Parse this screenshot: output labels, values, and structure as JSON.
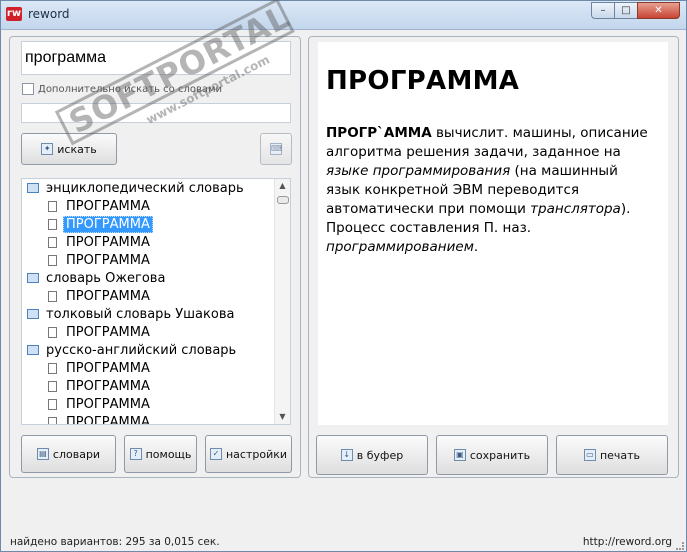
{
  "window": {
    "title": "reword",
    "icon_text": "rw",
    "buttons": {
      "minimize": "–",
      "maximize": "□",
      "close": "✕"
    }
  },
  "search": {
    "value": "программа",
    "option_label": "Дополнительно искать со словами",
    "extra_value": "",
    "search_label": "искать"
  },
  "tree": {
    "items": [
      {
        "type": "dict",
        "label": "энциклопедический словарь"
      },
      {
        "type": "entry",
        "label": "ПРОГРАММА"
      },
      {
        "type": "entry",
        "label": "ПРОГРАММА",
        "selected": true
      },
      {
        "type": "entry",
        "label": "ПРОГРАММА"
      },
      {
        "type": "entry",
        "label": "ПРОГРАММА"
      },
      {
        "type": "dict",
        "label": "словарь Ожегова"
      },
      {
        "type": "entry",
        "label": "ПРОГРАММА"
      },
      {
        "type": "dict",
        "label": "толковый словарь Ушакова"
      },
      {
        "type": "entry",
        "label": "ПРОГРАММА"
      },
      {
        "type": "dict",
        "label": "русско-английский словарь"
      },
      {
        "type": "entry",
        "label": "ПРОГРАММА"
      },
      {
        "type": "entry",
        "label": "ПРОГРАММА"
      },
      {
        "type": "entry",
        "label": "ПРОГРАММА"
      },
      {
        "type": "entry",
        "label": "ПРОГРАММА"
      }
    ]
  },
  "left_buttons": {
    "dictionaries": "словари",
    "help": "помощь",
    "settings": "настройки"
  },
  "article": {
    "heading": "ПРОГРАММА",
    "headword": "ПРОГР`АММА",
    "part1": " вычислит. машины, описание алгоритма решения задачи, заданное на ",
    "italic1": "языке программирования",
    "part2": " (на машинный язык конкретной ЭВМ переводится автоматически при помощи ",
    "italic2": "транслятора",
    "part3": "). Процесс составления П. наз. ",
    "italic3": "программированием",
    "part4": "."
  },
  "right_buttons": {
    "copy": "в буфер",
    "save": "сохранить",
    "print": "печать"
  },
  "status": {
    "left": "найдено вариантов: 295 за 0,015 сек.",
    "right": "http://reword.org"
  },
  "watermark": {
    "brand": "SOFTPORTAL",
    "url": "www.softportal.com"
  },
  "colors": {
    "selection": "#3399ff",
    "close_button": "#c84434",
    "titlebar": "#c3d6ec"
  }
}
